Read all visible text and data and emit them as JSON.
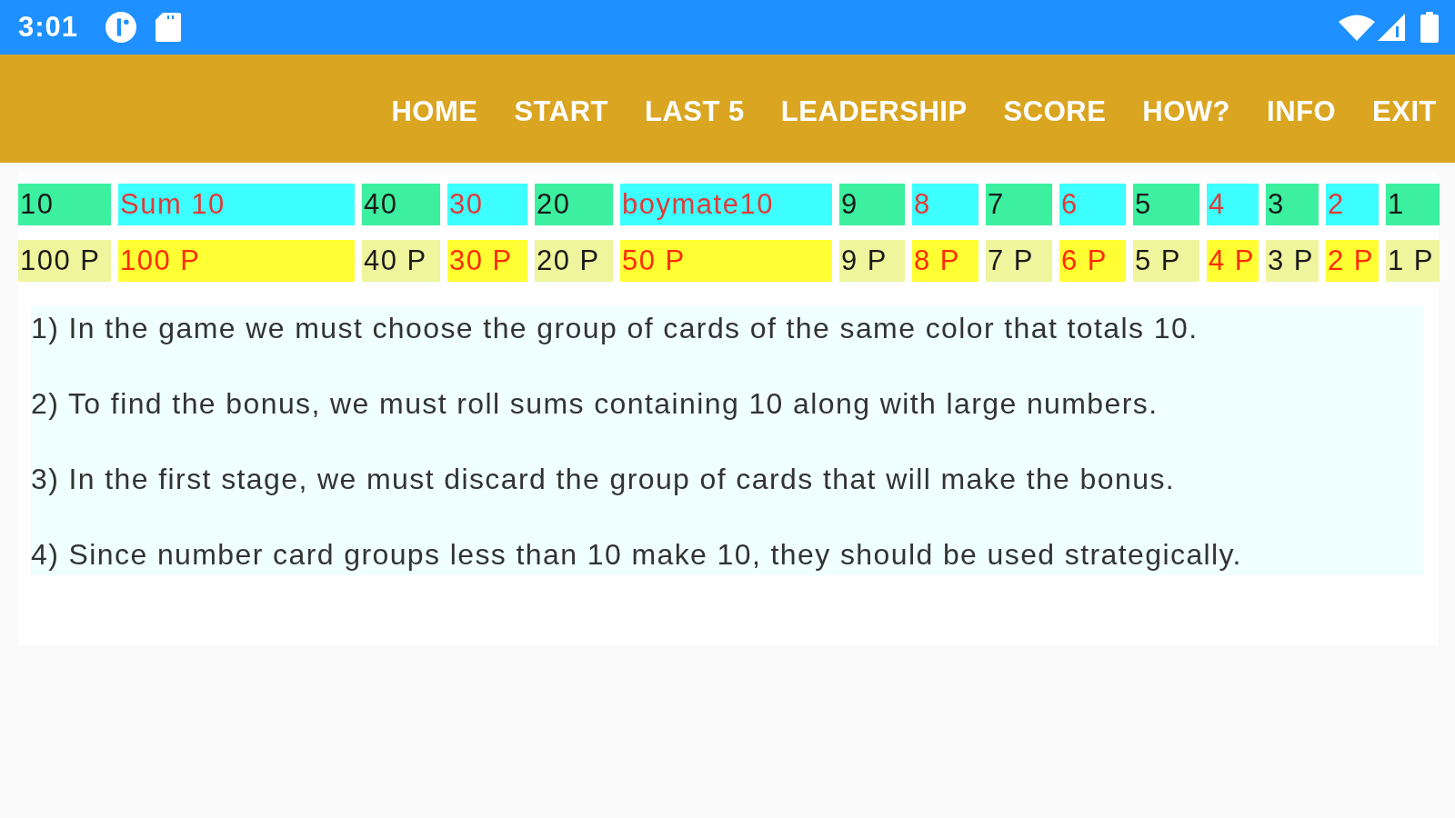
{
  "status_bar": {
    "time": "3:01"
  },
  "nav": {
    "items": [
      "HOME",
      "START",
      "LAST 5",
      "LEADERSHIP",
      "SCORE",
      "HOW?",
      "INFO",
      "EXIT"
    ]
  },
  "score_table": {
    "columns": [
      {
        "label": "10",
        "points": "100 P",
        "kind": "plain"
      },
      {
        "label": "Sum 10",
        "points": "100 P",
        "kind": "accent"
      },
      {
        "label": "40",
        "points": "40 P",
        "kind": "plain"
      },
      {
        "label": "30",
        "points": "30 P",
        "kind": "accent"
      },
      {
        "label": "20",
        "points": "20 P",
        "kind": "plain"
      },
      {
        "label": "boymate10",
        "points": "50 P",
        "kind": "accent"
      },
      {
        "label": "9",
        "points": "9 P",
        "kind": "plain"
      },
      {
        "label": "8",
        "points": "8 P",
        "kind": "accent"
      },
      {
        "label": "7",
        "points": "7 P",
        "kind": "plain"
      },
      {
        "label": "6",
        "points": "6 P",
        "kind": "accent"
      },
      {
        "label": "5",
        "points": "5 P",
        "kind": "plain"
      },
      {
        "label": "4",
        "points": "4 P",
        "kind": "accent"
      },
      {
        "label": "3",
        "points": "3 P",
        "kind": "plain"
      },
      {
        "label": "2",
        "points": "2 P",
        "kind": "accent"
      },
      {
        "label": "1",
        "points": "1 P",
        "kind": "plain"
      }
    ]
  },
  "rules": [
    "1) In the game we must choose the group of cards of the same color that totals 10.",
    "2) To find the bonus, we must roll sums containing 10 along with large numbers.",
    "3) In the first stage, we must discard the group of cards that will make the bonus.",
    "4) Since number card groups less than 10 make 10, they should be used strategically."
  ]
}
